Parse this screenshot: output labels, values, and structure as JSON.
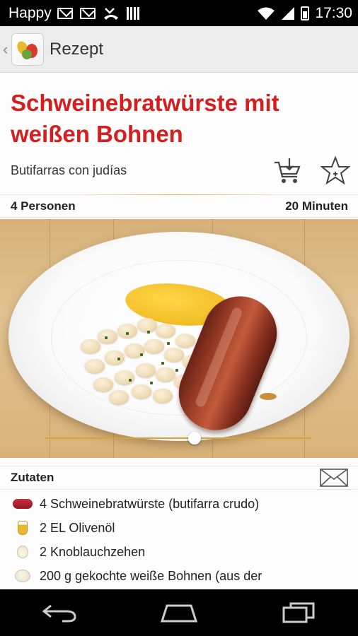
{
  "status_bar": {
    "carrier": "Happy",
    "time": "17:30",
    "icons": [
      "mail-icon",
      "mail-icon",
      "missed-call-icon",
      "barcode-icon",
      "wifi-icon",
      "signal-icon",
      "battery-icon"
    ]
  },
  "action_bar": {
    "title": "Rezept",
    "icons": [
      "up-caret-icon",
      "app-logo-icon"
    ]
  },
  "recipe": {
    "title": "Schweinebratwürste mit weißen Bohnen",
    "subtitle": "Butifarras con judías",
    "persons": "4 Personen",
    "duration": "20 Minuten",
    "action_icons": [
      "shopping-cart-icon",
      "favorite-star-icon"
    ]
  },
  "photo": {
    "slider_position": 0.56
  },
  "ingredients": {
    "header": "Zutaten",
    "share_icon": "envelope-icon",
    "items": [
      {
        "icon": "sausage-icon",
        "text": "4  Schweinebratwürste (butifarra crudo)"
      },
      {
        "icon": "olive-oil-icon",
        "text": "2 EL Olivenöl"
      },
      {
        "icon": "garlic-icon",
        "text": "2  Knoblauchzehen"
      },
      {
        "icon": "beans-icon",
        "text": "200 g gekochte weiße Bohnen (aus der"
      }
    ]
  },
  "nav_bar": {
    "icons": [
      "back-icon",
      "home-icon",
      "recent-apps-icon"
    ]
  },
  "colors": {
    "title_red": "#d51f1f",
    "accent_gold": "#e4b54a"
  }
}
